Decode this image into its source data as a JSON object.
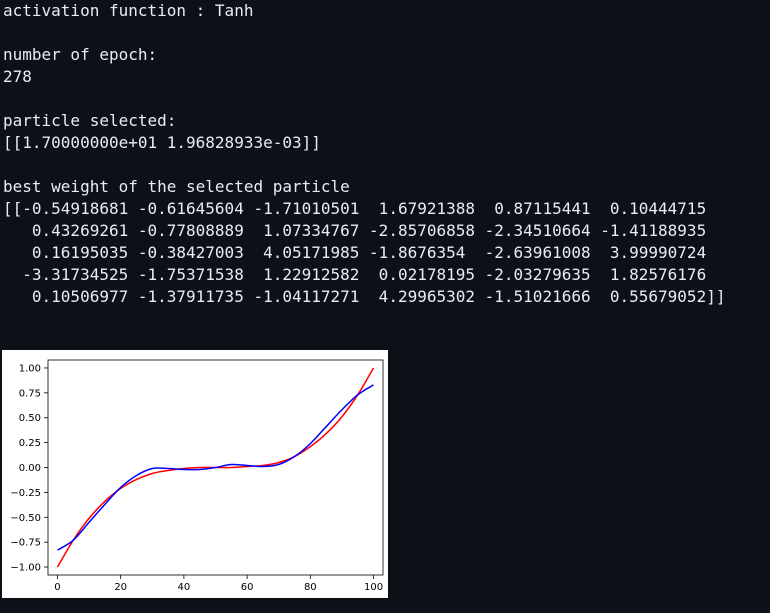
{
  "console": {
    "activation_line": "activation function : Tanh",
    "epoch_label": "number of epoch:",
    "epoch_value": "278",
    "particle_label": "particle selected:",
    "particle_value": "[[1.70000000e+01 1.96828933e-03]]",
    "weight_label": "best weight of the selected particle",
    "weight_rows": [
      "[[-0.54918681 -0.61645604 -1.71010501  1.67921388  0.87115441  0.10444715",
      "   0.43269261 -0.77808889  1.07334767 -2.85706858 -2.34510664 -1.41188935",
      "   0.16195035 -0.38427003  4.05171985 -1.8676354  -2.63961008  3.99990724",
      "  -3.31734525 -1.75371538  1.22912582  0.02178195 -2.03279635  1.82576176",
      "   0.10506977 -1.37911735 -1.04117271  4.29965302 -1.51021666  0.55679052]]"
    ]
  },
  "chart_data": {
    "type": "line",
    "title": "",
    "xlabel": "",
    "ylabel": "",
    "xlim": [
      -3,
      103
    ],
    "ylim": [
      -1.08,
      1.08
    ],
    "xticks": [
      0,
      20,
      40,
      60,
      80,
      100
    ],
    "yticks": [
      -1.0,
      -0.75,
      -0.5,
      -0.25,
      0.0,
      0.25,
      0.5,
      0.75,
      1.0
    ],
    "ytick_labels": [
      "−1.00",
      "−0.75",
      "−0.50",
      "−0.25",
      "0.00",
      "0.25",
      "0.50",
      "0.75",
      "1.00"
    ],
    "xtick_labels": [
      "0",
      "20",
      "40",
      "60",
      "80",
      "100"
    ],
    "grid": false,
    "legend": "none",
    "series": [
      {
        "color": "#ff0000",
        "x": [
          0,
          5,
          10,
          15,
          20,
          25,
          30,
          35,
          40,
          45,
          50,
          55,
          60,
          65,
          70,
          75,
          80,
          85,
          90,
          95,
          100
        ],
        "y": [
          -1.0,
          -0.73,
          -0.51,
          -0.34,
          -0.21,
          -0.12,
          -0.06,
          -0.03,
          -0.01,
          0.0,
          0.0,
          0.0,
          0.01,
          0.02,
          0.05,
          0.11,
          0.21,
          0.34,
          0.51,
          0.73,
          1.0
        ]
      },
      {
        "color": "#0000ff",
        "x": [
          0,
          5,
          10,
          15,
          20,
          25,
          30,
          35,
          40,
          45,
          50,
          55,
          60,
          65,
          70,
          75,
          80,
          85,
          90,
          95,
          100
        ],
        "y": [
          -0.83,
          -0.73,
          -0.55,
          -0.37,
          -0.2,
          -0.08,
          -0.01,
          -0.01,
          -0.02,
          -0.02,
          0.0,
          0.03,
          0.02,
          0.01,
          0.03,
          0.11,
          0.24,
          0.41,
          0.58,
          0.73,
          0.83
        ]
      }
    ]
  }
}
